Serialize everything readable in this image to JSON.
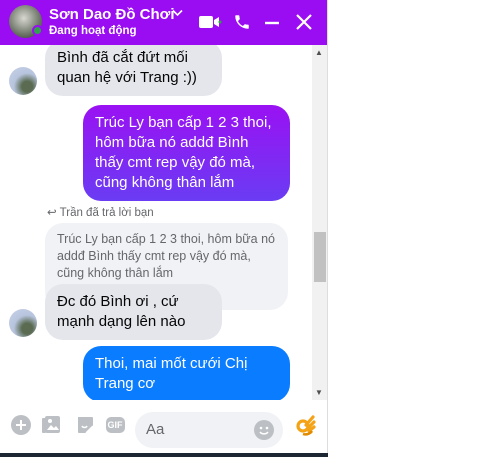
{
  "header": {
    "name": "Sơn Dao Đồ Chơi",
    "status": "Đang hoạt động"
  },
  "messages": [
    {
      "type": "received",
      "text": "Bình đã cắt đứt mối quan hệ với Trang :))"
    },
    {
      "type": "sent",
      "text": "Trúc Ly bạn cấp 1 2 3 thoi, hôm bữa nó addđ Bình thấy cmt rep vậy đó mà, cũng không thân lắm"
    },
    {
      "type": "reply_label",
      "text": "Trần đã trả lời bạn"
    },
    {
      "type": "quoted",
      "text": "Trúc Ly bạn cấp 1 2 3 thoi, hôm bữa nó addđ Bình thấy cmt rep vậy đó mà, cũng không thân lắm"
    },
    {
      "type": "received",
      "text": "Đc đó Bình ơi , cứ mạnh dạng lên nào"
    },
    {
      "type": "sent",
      "text": "Thoi, mai mốt cưới Chị Trang cơ"
    }
  ],
  "composer": {
    "placeholder": "Aa",
    "gif_label": "GIF"
  },
  "colors": {
    "header": "#9a0cf2",
    "sent_blue": "#0a7cff"
  }
}
